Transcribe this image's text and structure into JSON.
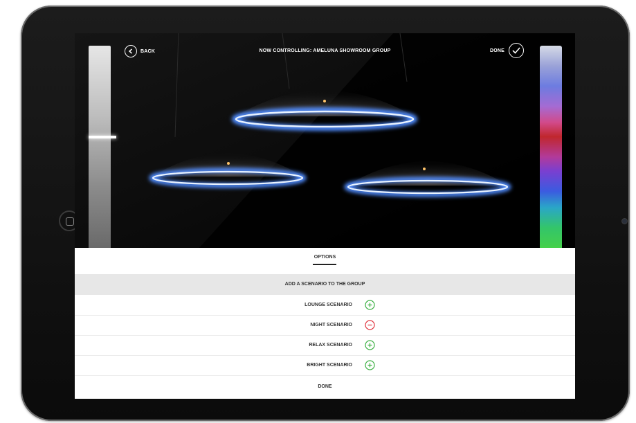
{
  "header": {
    "back_label": "BACK",
    "title": "NOW CONTROLLING: AMELUNA SHOWROOM GROUP",
    "done_label": "DONE"
  },
  "panel": {
    "tab_label": "OPTIONS",
    "section_header": "ADD A SCENARIO TO THE GROUP",
    "scenarios": [
      {
        "label": "LOUNGE SCENARIO",
        "action": "add-icon",
        "color": "#3cb043"
      },
      {
        "label": "NIGHT SCENARIO",
        "action": "remove-icon",
        "color": "#e0343f"
      },
      {
        "label": "RELAX SCENARIO",
        "action": "add-icon",
        "color": "#3cb043"
      },
      {
        "label": "BRIGHT SCENARIO",
        "action": "add-icon",
        "color": "#3cb043"
      }
    ],
    "done_label": "DONE"
  },
  "colors": {
    "add": "#3cb043",
    "remove": "#e0343f",
    "lamp_ring": "#9ec8ff"
  }
}
